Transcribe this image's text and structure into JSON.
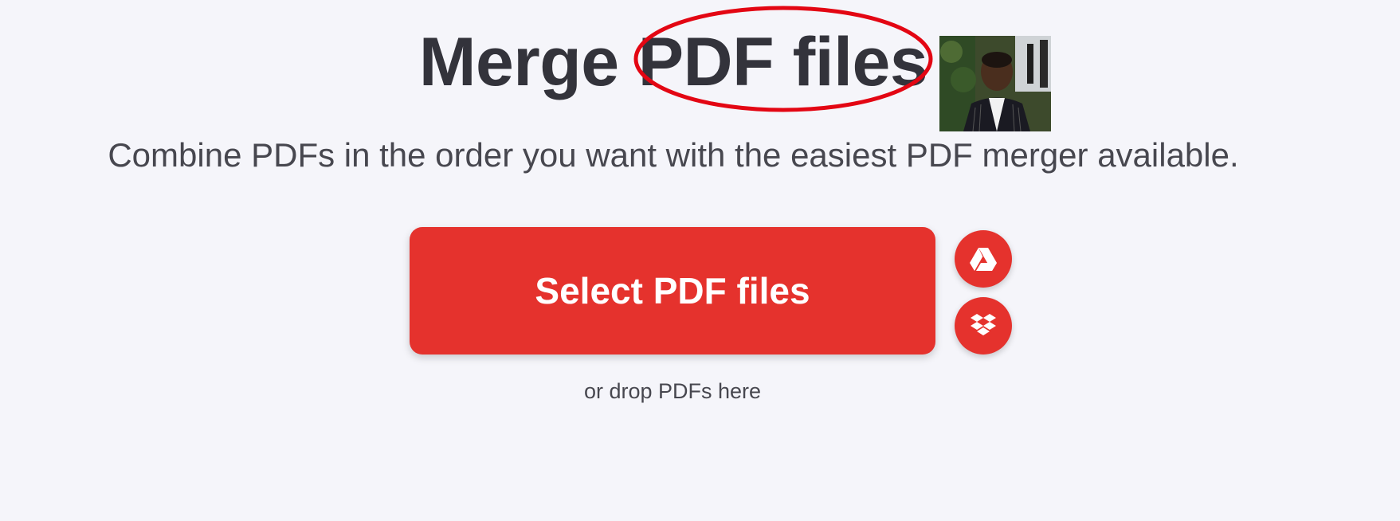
{
  "header": {
    "title_part1": "Merge",
    "title_part2": "PDF files",
    "subtitle": "Combine PDFs in the order you want with the easiest PDF merger available."
  },
  "upload": {
    "select_label": "Select PDF files",
    "drop_hint": "or drop PDFs here"
  },
  "cloud_sources": {
    "google_drive_icon": "google-drive-icon",
    "dropbox_icon": "dropbox-icon"
  },
  "colors": {
    "accent": "#e5322d",
    "background": "#f5f5fa",
    "text": "#33333b",
    "annotation": "#e30613"
  }
}
